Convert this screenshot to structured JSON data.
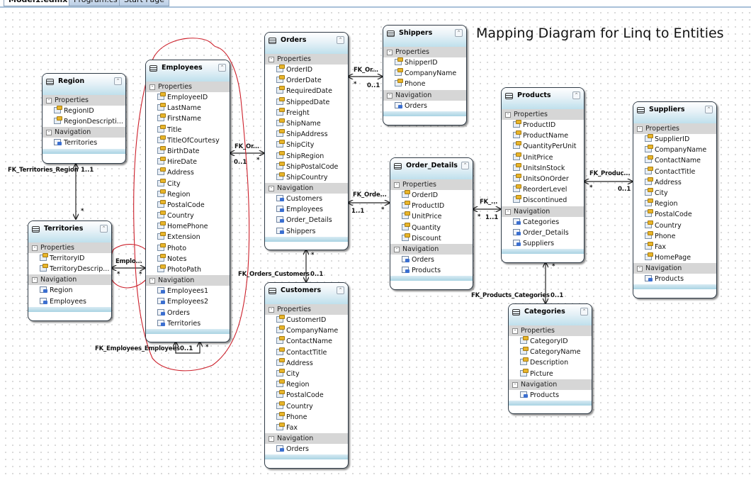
{
  "tabs": [
    {
      "label": "Model1.edmx",
      "active": true
    },
    {
      "label": "Program.cs",
      "active": false
    },
    {
      "label": "Start Page",
      "active": false
    }
  ],
  "diagram_title": "Mapping Diagram for Linq to Entities",
  "section_labels": {
    "properties": "Properties",
    "navigation": "Navigation"
  },
  "entities": {
    "region": {
      "name": "Region",
      "properties": [
        "RegionID",
        "RegionDescripti..."
      ],
      "navigation": [
        "Territories"
      ]
    },
    "territories": {
      "name": "Territories",
      "properties": [
        "TerritoryID",
        "TerritoryDescrip..."
      ],
      "navigation": [
        "Region",
        "Employees"
      ]
    },
    "employees": {
      "name": "Employees",
      "properties": [
        "EmployeeID",
        "LastName",
        "FirstName",
        "Title",
        "TitleOfCourtesy",
        "BirthDate",
        "HireDate",
        "Address",
        "City",
        "Region",
        "PostalCode",
        "Country",
        "HomePhone",
        "Extension",
        "Photo",
        "Notes",
        "PhotoPath"
      ],
      "navigation": [
        "Employees1",
        "Employees2",
        "Orders",
        "Territories"
      ]
    },
    "orders": {
      "name": "Orders",
      "properties": [
        "OrderID",
        "OrderDate",
        "RequiredDate",
        "ShippedDate",
        "Freight",
        "ShipName",
        "ShipAddress",
        "ShipCity",
        "ShipRegion",
        "ShipPostalCode",
        "ShipCountry"
      ],
      "navigation": [
        "Customers",
        "Employees",
        "Order_Details",
        "Shippers"
      ]
    },
    "customers": {
      "name": "Customers",
      "properties": [
        "CustomerID",
        "CompanyName",
        "ContactName",
        "ContactTitle",
        "Address",
        "City",
        "Region",
        "PostalCode",
        "Country",
        "Phone",
        "Fax"
      ],
      "navigation": [
        "Orders"
      ]
    },
    "shippers": {
      "name": "Shippers",
      "properties": [
        "ShipperID",
        "CompanyName",
        "Phone"
      ],
      "navigation": [
        "Orders"
      ]
    },
    "order_details": {
      "name": "Order_Details",
      "properties": [
        "OrderID",
        "ProductID",
        "UnitPrice",
        "Quantity",
        "Discount"
      ],
      "navigation": [
        "Orders",
        "Products"
      ]
    },
    "products": {
      "name": "Products",
      "properties": [
        "ProductID",
        "ProductName",
        "QuantityPerUnit",
        "UnitPrice",
        "UnitsInStock",
        "UnitsOnOrder",
        "ReorderLevel",
        "Discontinued"
      ],
      "navigation": [
        "Categories",
        "Order_Details",
        "Suppliers"
      ]
    },
    "suppliers": {
      "name": "Suppliers",
      "properties": [
        "SupplierID",
        "CompanyName",
        "ContactName",
        "ContactTitle",
        "Address",
        "City",
        "Region",
        "PostalCode",
        "Country",
        "Phone",
        "Fax",
        "HomePage"
      ],
      "navigation": [
        "Products"
      ]
    },
    "categories": {
      "name": "Categories",
      "properties": [
        "CategoryID",
        "CategoryName",
        "Description",
        "Picture"
      ],
      "navigation": [
        "Products"
      ]
    }
  },
  "associations": {
    "fk_territories_region": {
      "label": "FK_Territories_Region",
      "end1": "1..1",
      "end2": "*"
    },
    "employee_territories": {
      "label": "Emplo...",
      "end1": "*",
      "end2": "*"
    },
    "fk_orders_employees": {
      "label": "FK_Or...",
      "end1": "0..1",
      "end2": "*"
    },
    "fk_employees_employees": {
      "label": "FK_Employees_Employees",
      "end1": "0..1",
      "end2": "*"
    },
    "fk_orders_shippers": {
      "label": "FK_Or...",
      "end1": "*",
      "end2": "0..1"
    },
    "fk_orders_customers": {
      "label": "FK_Orders_Customers",
      "end1": "*",
      "end2": "0..1"
    },
    "fk_order_details_orders": {
      "label": "FK_Orde...",
      "end1": "1..1",
      "end2": "*"
    },
    "fk_order_details_products": {
      "label": "FK_...",
      "end1": "*",
      "end2": "1..1"
    },
    "fk_products_suppliers": {
      "label": "FK_Produc...",
      "end1": "*",
      "end2": "0..1"
    },
    "fk_products_categories": {
      "label": "FK_Products_Categories",
      "end1": "*",
      "end2": "0..1"
    }
  },
  "annotation_color": "#cc1f2a"
}
